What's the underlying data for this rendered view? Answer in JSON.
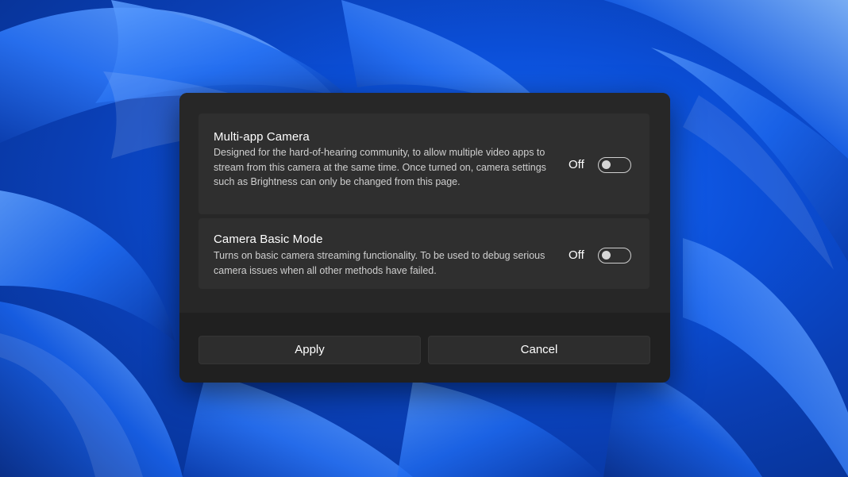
{
  "dialog": {
    "settings": [
      {
        "title": "Multi-app Camera",
        "description": "Designed for the hard-of-hearing community, to allow multiple video apps to stream from this camera at the same time. Once turned on, camera settings such as Brightness can only be changed from this page.",
        "state_label": "Off",
        "enabled": false
      },
      {
        "title": "Camera Basic Mode",
        "description": "Turns on basic camera streaming functionality. To be used to debug serious camera issues when all other methods have failed.",
        "state_label": "Off",
        "enabled": false
      }
    ],
    "buttons": {
      "apply_label": "Apply",
      "cancel_label": "Cancel"
    }
  },
  "colors": {
    "wallpaper_accent": "#0b4fd8",
    "dialog_background": "#202020",
    "card_background": "#2f2f2f"
  }
}
